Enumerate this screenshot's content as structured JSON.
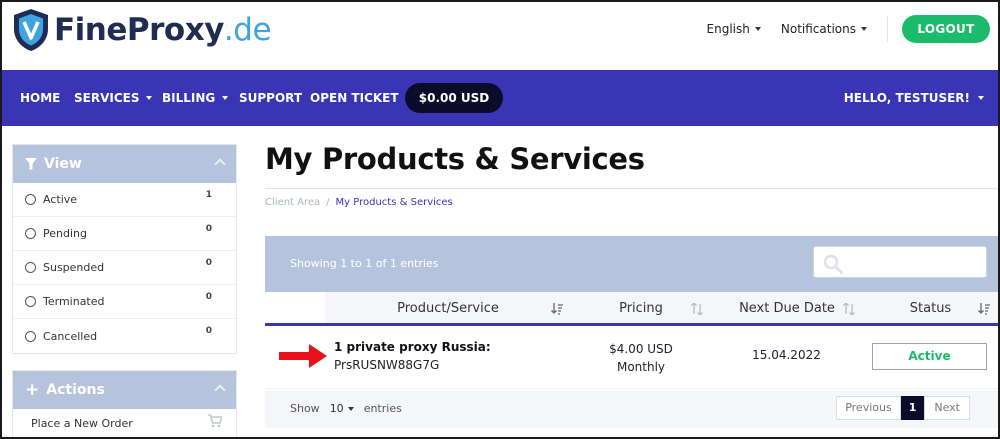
{
  "brand": {
    "fine": "Fine",
    "proxy": "Proxy",
    "de": ".de"
  },
  "header": {
    "language": "English",
    "notifications": "Notifications",
    "logout_label": "LOGOUT"
  },
  "nav": {
    "items": [
      "HOME",
      "SERVICES",
      "BILLING",
      "SUPPORT",
      "OPEN TICKET"
    ],
    "balance": "$0.00 USD",
    "user_greeting": "HELLO, TESTUSER!"
  },
  "sidebar": {
    "view_title": "View",
    "filters": [
      {
        "label": "Active",
        "count": "1"
      },
      {
        "label": "Pending",
        "count": "0"
      },
      {
        "label": "Suspended",
        "count": "0"
      },
      {
        "label": "Terminated",
        "count": "0"
      },
      {
        "label": "Cancelled",
        "count": "0"
      }
    ],
    "actions_title": "Actions",
    "actions": [
      {
        "label": "Place a New Order"
      }
    ]
  },
  "main": {
    "title": "My Products & Services",
    "breadcrumb": {
      "home": "Client Area",
      "separator": "/",
      "current": "My Products & Services"
    }
  },
  "table": {
    "info": "Showing 1 to 1 of 1 entries",
    "columns": [
      "Product/Service",
      "Pricing",
      "Next Due Date",
      "Status"
    ],
    "rows": [
      {
        "product": "1 private proxy Russia:",
        "product_id": "PrsRUSNW88G7G",
        "price": "$4.00 USD",
        "cycle": "Monthly",
        "due": "15.04.2022",
        "status": "Active"
      }
    ],
    "footer": {
      "show_label": "Show",
      "page_size": "10",
      "entries_label": "entries",
      "pager": {
        "previous": "Previous",
        "current": "1",
        "next": "Next"
      }
    }
  },
  "colors": {
    "nav": "#3a35b5",
    "panel_header": "#b5c4dc",
    "green": "#1abc6c",
    "dark": "#0c0c2a",
    "arrow": "#e8111a"
  }
}
